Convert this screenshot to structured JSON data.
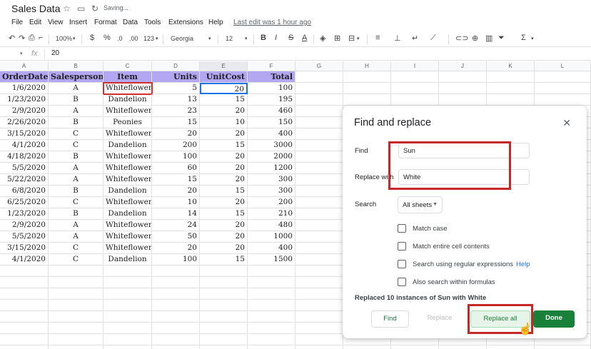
{
  "app": {
    "title": "Sales Data",
    "status": "Saving...",
    "last_edit": "Last edit was 1 hour ago"
  },
  "menu": [
    "File",
    "Edit",
    "View",
    "Insert",
    "Format",
    "Data",
    "Tools",
    "Extensions",
    "Help"
  ],
  "toolbar": {
    "zoom": "100%",
    "currency": "$",
    "percent": "%",
    "decrease_decimal": ".0",
    "increase_decimal": ".00",
    "more_formats": "123",
    "font": "Georgia",
    "font_size": "12",
    "bold": "B",
    "italic": "I",
    "strike": "S",
    "text_color": "A",
    "sigma": "Σ"
  },
  "formula_bar": {
    "cell_ref": "",
    "fx": "fx",
    "value": "20"
  },
  "columns": [
    "A",
    "B",
    "C",
    "D",
    "E",
    "F",
    "G",
    "H",
    "I",
    "J",
    "K",
    "L"
  ],
  "sheet": {
    "headers": [
      "OrderDate",
      "Salesperson",
      "Item",
      "Units",
      "UnitCost",
      "Total"
    ],
    "rows": [
      [
        "1/6/2020",
        "A",
        "Whiteflowers",
        "5",
        "20",
        "100"
      ],
      [
        "1/23/2020",
        "B",
        "Dandelion",
        "13",
        "15",
        "195"
      ],
      [
        "2/9/2020",
        "A",
        "Whiteflowers",
        "23",
        "20",
        "460"
      ],
      [
        "2/26/2020",
        "B",
        "Peonies",
        "15",
        "10",
        "150"
      ],
      [
        "3/15/2020",
        "C",
        "Whiteflowers",
        "20",
        "20",
        "400"
      ],
      [
        "4/1/2020",
        "C",
        "Dandelion",
        "200",
        "15",
        "3000"
      ],
      [
        "4/18/2020",
        "B",
        "Whiteflowers",
        "100",
        "20",
        "2000"
      ],
      [
        "5/5/2020",
        "A",
        "Whiteflowers",
        "60",
        "20",
        "1200"
      ],
      [
        "5/22/2020",
        "A",
        "Whiteflowers",
        "15",
        "20",
        "300"
      ],
      [
        "6/8/2020",
        "B",
        "Dandelion",
        "20",
        "15",
        "300"
      ],
      [
        "6/25/2020",
        "C",
        "Whiteflowers",
        "10",
        "20",
        "200"
      ],
      [
        "1/23/2020",
        "B",
        "Dandelion",
        "14",
        "15",
        "210"
      ],
      [
        "2/9/2020",
        "A",
        "Whiteflowers",
        "24",
        "20",
        "480"
      ],
      [
        "5/5/2020",
        "A",
        "Whiteflowers",
        "50",
        "20",
        "1000"
      ],
      [
        "3/15/2020",
        "C",
        "Whiteflowers",
        "20",
        "20",
        "400"
      ],
      [
        "4/1/2020",
        "C",
        "Dandelion",
        "100",
        "15",
        "1500"
      ]
    ]
  },
  "dialog": {
    "title": "Find and replace",
    "find_label": "Find",
    "find_value": "Sun",
    "replace_label": "Replace with",
    "replace_value": "White",
    "search_label": "Search",
    "search_value": "All sheets",
    "options": [
      "Match case",
      "Match entire cell contents",
      "Search using regular expressions",
      "Also search within formulas"
    ],
    "help_label": "Help",
    "status": "Replaced 10 instances of Sun with White",
    "find_button": "Find",
    "replace_button": "Replace",
    "replace_all_button": "Replace all",
    "done_button": "Done"
  },
  "colors": {
    "header_fill": "#b4a7f2",
    "highlight": "#c62828",
    "done_green": "#188038",
    "selection_blue": "#1a73e8"
  }
}
